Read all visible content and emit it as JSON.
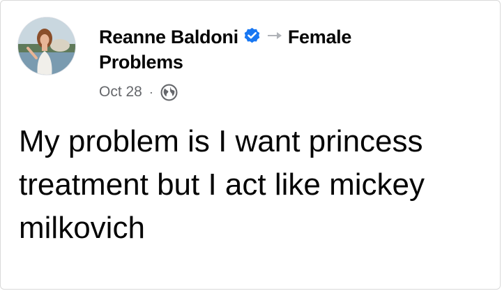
{
  "post": {
    "author_name": "Reanne Baldoni",
    "group_name_line1": "Female",
    "group_name_line2": "Problems",
    "date": "Oct 28",
    "separator": "·",
    "text": "My problem is I want princess treatment but I act like mickey milkovich"
  },
  "icons": {
    "verified": "verified-badge-icon",
    "arrow": "share-arrow-icon",
    "audience": "globe-icon"
  },
  "colors": {
    "verified_blue": "#1877f2",
    "meta_gray": "#65676b",
    "text": "#050505"
  }
}
